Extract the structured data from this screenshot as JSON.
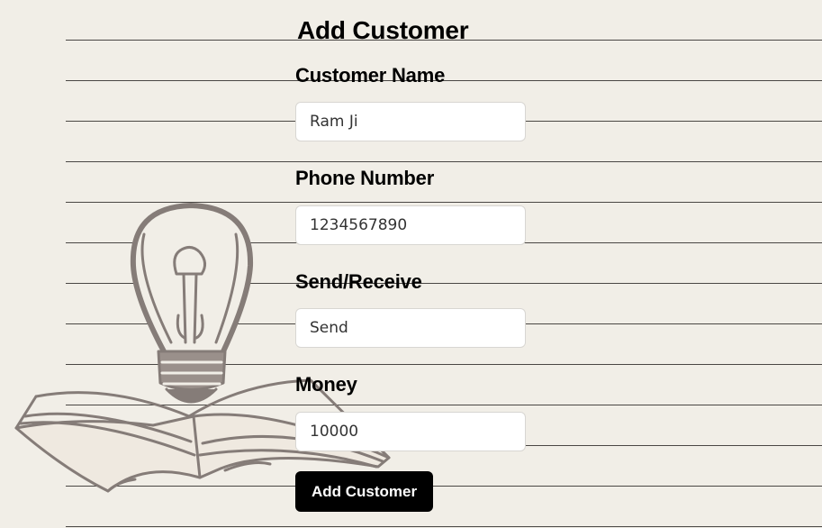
{
  "form": {
    "title": "Add Customer",
    "fields": [
      {
        "label": "Customer Name",
        "value": "Ram Ji"
      },
      {
        "label": "Phone Number",
        "value": "1234567890"
      },
      {
        "label": "Send/Receive",
        "value": "Send"
      },
      {
        "label": "Money",
        "value": "10000"
      }
    ],
    "submit_label": "Add Customer"
  },
  "theme": {
    "background": "#f1eee7",
    "rule_color": "#4a4744",
    "illustration_color": "#857c78",
    "button_color": "#000000"
  },
  "decoration": {
    "illustration_icon": "lightbulb-over-open-book"
  }
}
